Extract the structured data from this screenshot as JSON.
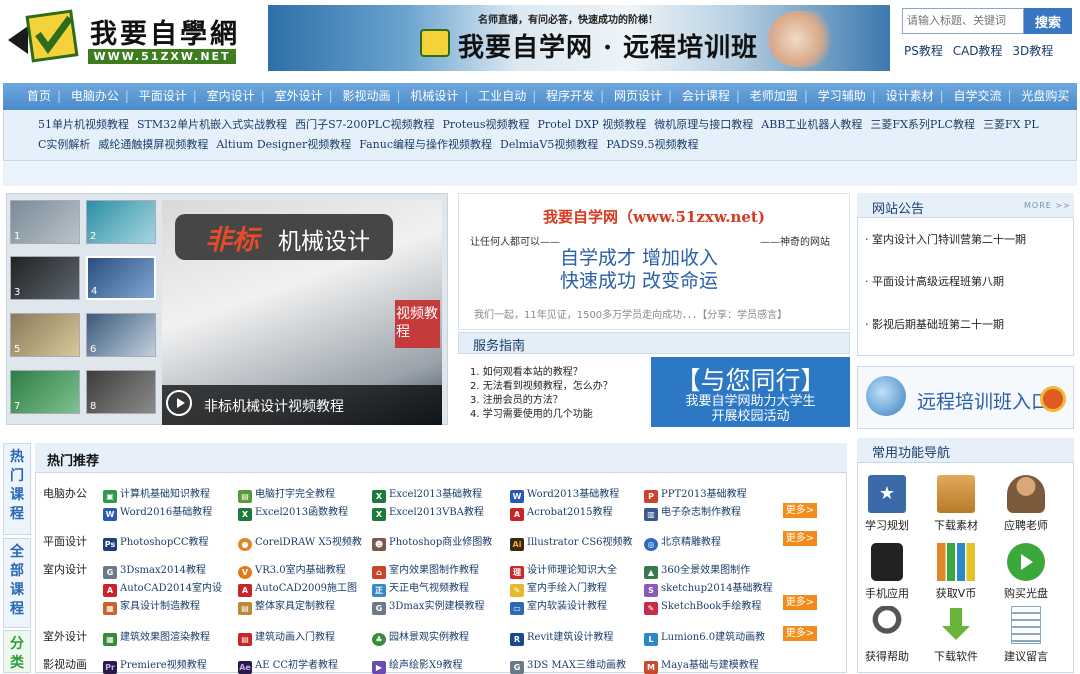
{
  "logo": {
    "title": "我要自學網",
    "url_text": "WWW.51ZXW.NET"
  },
  "banner": {
    "subtitle": "名师直播，有问必答，快速成功的阶梯！",
    "title": "我要自学网 · 远程培训班"
  },
  "search": {
    "placeholder": "请输入标题、关键词",
    "button": "搜索"
  },
  "quick_links": [
    "PS教程",
    "CAD教程",
    "3D教程"
  ],
  "nav": {
    "items": [
      "首页",
      "电脑办公",
      "平面设计",
      "室内设计",
      "室外设计",
      "影视动画",
      "机械设计",
      "工业自动",
      "程序开发",
      "网页设计",
      "会计课程",
      "老师加盟",
      "学习辅助",
      "设计素材",
      "自学交流",
      "光盘购买"
    ],
    "sub_items": [
      "51单片机视频教程",
      "STM32单片机嵌入式实战教程",
      "西门子S7-200PLC视频教程",
      "Proteus视频教程",
      "Protel DXP 视频教程",
      "微机原理与接口教程",
      "ABB工业机器人教程",
      "三菱FX系列PLC教程",
      "三菱FX PL",
      "C实例解析",
      "威纶通触摸屏视频教程",
      "Altium Designer视频教程",
      "Fanuc编程与操作视频教程",
      "DelmiaV5视频教程",
      "PADS9.5视频教程"
    ]
  },
  "slideshow": {
    "thumb_numbers": [
      "1",
      "2",
      "3",
      "4",
      "5",
      "6",
      "7",
      "8"
    ],
    "tag_a": "非标",
    "tag_b": "机械设计",
    "side_text": "视频教程",
    "caption": "非标机械设计视频教程"
  },
  "intro": {
    "title": "我要自学网（www.51zxw.net)",
    "left": "让任何人都可以——",
    "right": "——神奇的网站",
    "slogan1": "自学成才 增加收入",
    "slogan2": "快速成功 改变命运",
    "foot": "我们一起，11年见证，1500多万学员走向成功．．．【分享：学员感言】"
  },
  "service": {
    "title": "服务指南",
    "items": [
      "1. 如何观看本站的教程？",
      "2. 无法看到视频教程，怎么办？",
      "3. 注册会员的方法？",
      "4. 学习需要使用的几个功能"
    ]
  },
  "promo": {
    "headline": "【与您同行】",
    "line1": "我要自学网助力大学生",
    "line2": "开展校园活动"
  },
  "notice": {
    "title": "网站公告",
    "more": "MORE >>",
    "items": [
      "· 室内设计入门特训营第二十一期",
      "· 平面设计高级远程班第八期",
      "· 影视后期基础班第二十一期"
    ]
  },
  "remote": {
    "label": "远程培训班入口"
  },
  "side_tabs": [
    {
      "label": "热门课程",
      "color": "#2a67b5"
    },
    {
      "label": "全部课程",
      "color": "#2a67b5"
    },
    {
      "label": "分类",
      "color": "#2d9c3c"
    }
  ],
  "hot": {
    "title": "热门推荐",
    "more_label": "更多>",
    "categories": [
      "电脑办公",
      "平面设计",
      "室内设计",
      "室外设计",
      "影视动画"
    ],
    "courses": {
      "office": [
        "计算机基础知识教程",
        "电脑打字完全教程",
        "Excel2013基础教程",
        "Word2013基础教程",
        "PPT2013基础教程",
        "Word2016基础教程",
        "Excel2013函数教程",
        "Excel2013VBA教程",
        "Acrobat2015教程",
        "电子杂志制作教程"
      ],
      "graphic": [
        "PhotoshopCC教程",
        "CorelDRAW X5视频教",
        "Photoshop商业修图教",
        "Illustrator CS6视频教",
        "北京精雕教程"
      ],
      "interior": [
        "3Dsmax2014教程",
        "VR3.0室内基础教程",
        "室内效果图制作教程",
        "设计师理论知识大全",
        "360全景效果图制作",
        "AutoCAD2014室内设",
        "AutoCAD2009施工图",
        "天正电气视频教程",
        "室内手绘入门教程",
        "sketchup2014基础教程",
        "家具设计制造教程",
        "整体家具定制教程",
        "3Dmax实例建模教程",
        "室内软装设计教程",
        "SketchBook手绘教程"
      ],
      "exterior": [
        "建筑效果图渲染教程",
        "建筑动画入门教程",
        "园林景观实例教程",
        "Revit建筑设计教程",
        "Lumion6.0建筑动画教"
      ],
      "film": [
        "Premiere视频教程",
        "AE CC初学者教程",
        "绘声绘影X9教程",
        "3DS MAX三维动画教",
        "Maya基础与建模教程"
      ]
    }
  },
  "func": {
    "title": "常用功能导航",
    "items": [
      {
        "label": "学习规划",
        "icon": "study-plan-icon",
        "color": "#3a6aa8"
      },
      {
        "label": "下载素材",
        "icon": "download-box-icon",
        "color": "#c98b3a"
      },
      {
        "label": "应聘老师",
        "icon": "teacher-icon",
        "color": "#7a5a3a"
      },
      {
        "label": "手机应用",
        "icon": "mobile-app-icon",
        "color": "#222222"
      },
      {
        "label": "获取V币",
        "icon": "vcoin-chart-icon",
        "color": "#e3862a"
      },
      {
        "label": "购买光盘",
        "icon": "buy-disc-icon",
        "color": "#3aa83a"
      },
      {
        "label": "获得帮助",
        "icon": "help-icon",
        "color": "#555555"
      },
      {
        "label": "下载软件",
        "icon": "download-arrow-icon",
        "color": "#6cb33a"
      },
      {
        "label": "建议留言",
        "icon": "message-icon",
        "color": "#8aa8c4"
      }
    ]
  }
}
